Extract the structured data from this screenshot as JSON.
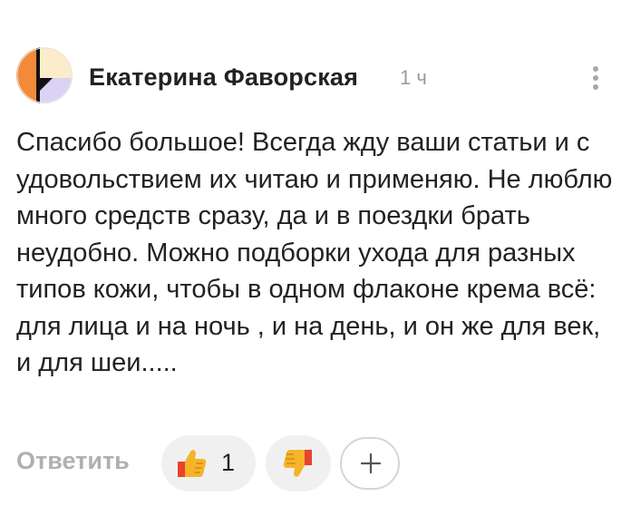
{
  "comment": {
    "author": "Екатерина Фаворская",
    "time": "1 ч",
    "text": "Спасибо большое! Всегда жду ваши статьи и с удовольствием их читаю и применяю. Не люблю много средств сразу, да и в поездки брать неудобно. Можно подборки ухода для разных типов кожи, чтобы в одном флаконе крема всё: для лица и на ночь , и на день, и он же для век, и для шеи.....",
    "avatar_icon": "avatar-geometric",
    "menu_icon": "more-vertical-icon"
  },
  "actions": {
    "reply_label": "Ответить",
    "like_icon": "thumbs-up-icon",
    "like_count": "1",
    "dislike_icon": "thumbs-down-icon",
    "add_icon": "plus-icon"
  },
  "colors": {
    "avatar_orange": "#f28a3a",
    "avatar_cream": "#fbeccb",
    "avatar_lavender": "#dcd2f5",
    "avatar_black": "#111111",
    "thumb_yellow": "#f5b42a",
    "thumb_red": "#e8432d",
    "muted_text": "#b0b0b0",
    "pill_bg": "#f0f0f0"
  }
}
